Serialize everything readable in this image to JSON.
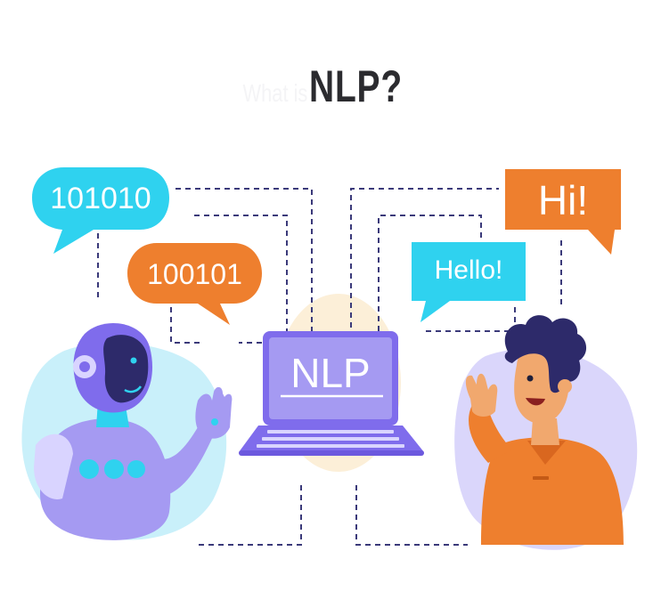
{
  "title": {
    "prefix": "What is",
    "main": "NLP?"
  },
  "bubbles": {
    "robot_top": "101010",
    "robot_bottom": "100101",
    "human_top": "Hi!",
    "human_bottom": "Hello!"
  },
  "laptop": {
    "screen_label": "NLP"
  },
  "colors": {
    "cyan": "#2fd2ef",
    "orange": "#ee7f2e",
    "purple": "#7f6cec",
    "lavender": "#a59af2",
    "dash": "#3b3a7a",
    "blob": "#dad6fb",
    "blob_cyan": "#c9f0fa",
    "cream": "#fcefd8"
  }
}
